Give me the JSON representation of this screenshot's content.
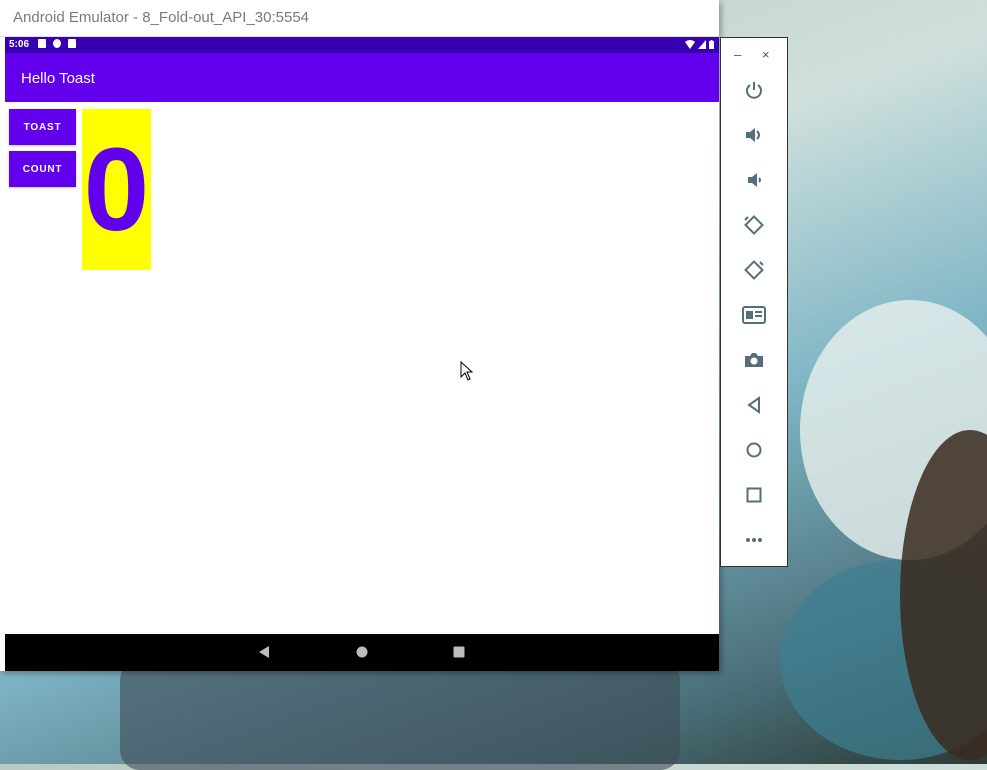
{
  "window": {
    "title": "Android Emulator - 8_Fold-out_API_30:5554"
  },
  "status_bar": {
    "time": "5:06",
    "icons": [
      "notification-a-icon",
      "notification-circle-icon",
      "sd-card-icon"
    ],
    "right_icons": [
      "wifi-icon",
      "signal-icon",
      "battery-icon"
    ]
  },
  "app_bar": {
    "title": "Hello Toast"
  },
  "buttons": {
    "toast_label": "TOAST",
    "count_label": "COUNT"
  },
  "counter": {
    "value": "0"
  },
  "nav_bar": {
    "buttons": [
      "back-icon",
      "home-icon",
      "recents-icon"
    ]
  },
  "side_panel": {
    "minimize_label": "–",
    "close_label": "×",
    "controls": [
      "power-icon",
      "volume-up-icon",
      "volume-down-icon",
      "rotate-left-icon",
      "rotate-right-icon",
      "screenshot-icon",
      "camera-icon",
      "back-icon",
      "home-icon",
      "overview-icon",
      "more-icon"
    ]
  },
  "colors": {
    "primary": "#6200ee",
    "primary_dark": "#3700b3",
    "counter_bg": "#ffff00"
  }
}
